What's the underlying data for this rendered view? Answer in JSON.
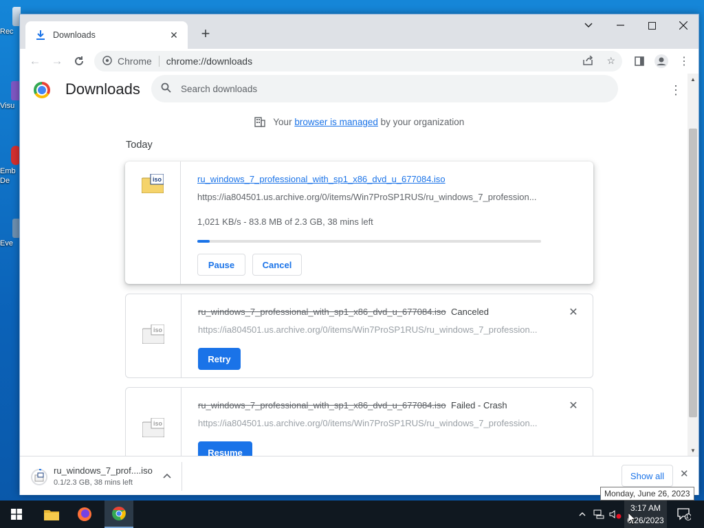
{
  "desktop": {
    "icons": [
      {
        "label": "Rec"
      },
      {
        "label": "Visu"
      },
      {
        "label": "Emb De"
      },
      {
        "label": "Eve"
      }
    ]
  },
  "browser": {
    "tab_title": "Downloads",
    "omnibox_label": "Chrome",
    "url": "chrome://downloads"
  },
  "downloads_page": {
    "title": "Downloads",
    "search_placeholder": "Search downloads",
    "managed_prefix": "Your",
    "managed_link": "browser is managed",
    "managed_suffix": "by your organization",
    "section_today": "Today",
    "items": [
      {
        "filename": "ru_windows_7_professional_with_sp1_x86_dvd_u_677084.iso",
        "url": "https://ia804501.us.archive.org/0/items/Win7ProSP1RUS/ru_windows_7_profession...",
        "progress_text": "1,021 KB/s - 83.8 MB of 2.3 GB, 38 mins left",
        "progress_fraction": 0.036,
        "buttons": [
          "Pause",
          "Cancel"
        ]
      },
      {
        "filename": "ru_windows_7_professional_with_sp1_x86_dvd_u_677084.iso",
        "status": "Canceled",
        "url": "https://ia804501.us.archive.org/0/items/Win7ProSP1RUS/ru_windows_7_profession...",
        "button": "Retry"
      },
      {
        "filename": "ru_windows_7_professional_with_sp1_x86_dvd_u_677084.iso",
        "status": "Failed - Crash",
        "url": "https://ia804501.us.archive.org/0/items/Win7ProSP1RUS/ru_windows_7_profession...",
        "button": "Resume"
      }
    ]
  },
  "shelf": {
    "item_name": "ru_windows_7_prof....iso",
    "item_status": "0.1/2.3 GB, 38 mins left",
    "show_all": "Show all"
  },
  "file_icon_label": "iso",
  "taskbar": {
    "time": "3:17 AM",
    "date": "6/26/2023",
    "tooltip": "Monday, June 26, 2023",
    "notification_count": "1"
  }
}
